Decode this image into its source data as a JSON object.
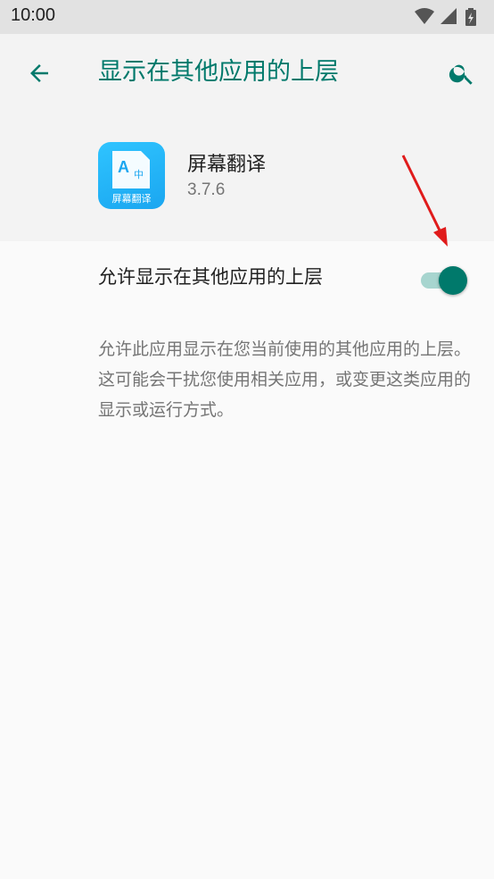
{
  "status_bar": {
    "time": "10:00",
    "icons": [
      "wifi-icon",
      "signal-icon",
      "battery-charging-icon"
    ]
  },
  "header": {
    "title": "显示在其他应用的上层",
    "back_icon": "arrow-back-icon",
    "search_icon": "search-icon",
    "accent_color": "#00796b"
  },
  "app": {
    "name": "屏幕翻译",
    "version": "3.7.6",
    "icon_label": "屏幕翻译",
    "icon_letter": "A",
    "icon_char": "中"
  },
  "setting": {
    "label": "允许显示在其他应用的上层",
    "enabled": true
  },
  "description": "允许此应用显示在您当前使用的其他应用的上层。这可能会干扰您使用相关应用，或变更这类应用的显示或运行方式。"
}
